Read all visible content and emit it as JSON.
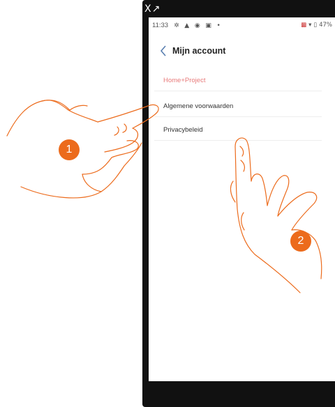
{
  "window": {
    "topbar_glyph": "X↗"
  },
  "statusbar": {
    "time": "11:33",
    "left_icons": [
      "gear-icon",
      "warning-icon",
      "eye-icon",
      "screen-icon",
      "dot-icon"
    ],
    "battery": "47%"
  },
  "header": {
    "title": "Mijn account",
    "back_icon": "chevron-left-icon"
  },
  "menu": {
    "items": [
      {
        "label": "Home+Project"
      },
      {
        "label": "Algemene voorwaarden"
      },
      {
        "label": "Privacybeleid"
      }
    ]
  },
  "navbar": {
    "buttons": [
      "back-triangle-icon",
      "home-circle-icon",
      "recents-square-icon"
    ]
  },
  "annotations": {
    "step1": "1",
    "step2": "2"
  },
  "colors": {
    "accent_item": "#e87a7a",
    "back_chevron": "#5a7fb0",
    "badge": "#ec6b1c",
    "hand_stroke": "#ec6b1c"
  }
}
